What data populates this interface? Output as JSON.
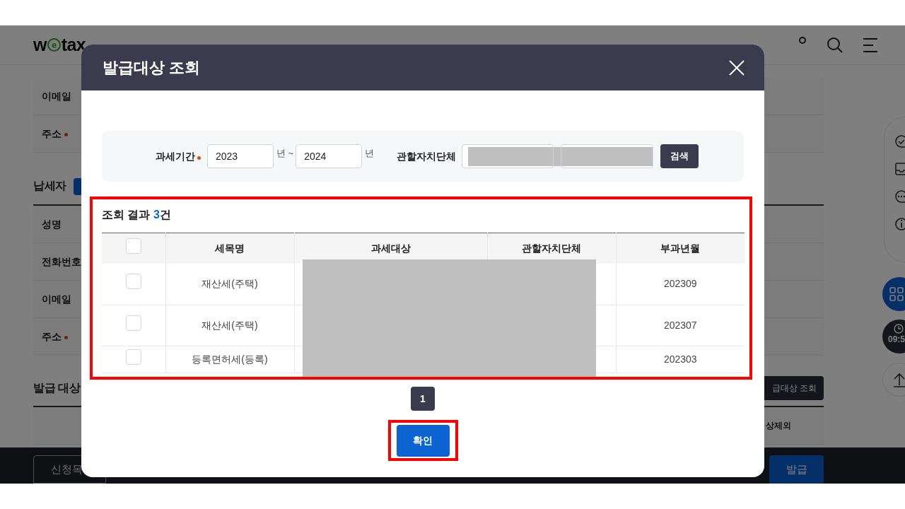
{
  "site": {
    "logo_left": "w",
    "logo_mid": "e",
    "logo_right": "tax"
  },
  "background": {
    "labels": [
      {
        "text": "이메일",
        "required": false
      },
      {
        "text": "주소",
        "required": true
      }
    ],
    "section": "납세자",
    "labels2": [
      {
        "text": "성명",
        "required": false
      },
      {
        "text": "전화번호",
        "required": false
      },
      {
        "text": "이메일",
        "required": false
      },
      {
        "text": "주소",
        "required": true
      }
    ],
    "section2": "발급 대상",
    "lookup_button": "급대상 조회",
    "column_cut": "상제외",
    "list_button": "신청목",
    "issue_button": "발급",
    "time": "09:5"
  },
  "modal": {
    "title": "발급대상 조회",
    "search": {
      "period_label": "과세기간",
      "period_required": true,
      "from": "2023",
      "from_unit": "년 ~",
      "to": "2024",
      "to_unit": "년",
      "region_label": "관할자치단체",
      "search_button": "검색"
    },
    "result": {
      "prefix": "조회 결과 ",
      "count": "3",
      "suffix": "건"
    },
    "table": {
      "header_checked": false,
      "columns": [
        "세목명",
        "과세대상",
        "관할자치단체",
        "부과년월"
      ],
      "rows": [
        {
          "checked": false,
          "tax": "재산세(주택)",
          "month": "202309"
        },
        {
          "checked": false,
          "tax": "재산세(주택)",
          "month": "202307"
        },
        {
          "checked": false,
          "tax": "등록면허세(등록)",
          "month": "202303"
        }
      ]
    },
    "pages": [
      {
        "label": "1",
        "selected": true
      }
    ],
    "confirm_button": "확인"
  }
}
